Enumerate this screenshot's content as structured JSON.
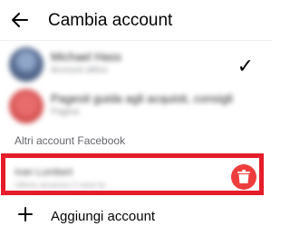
{
  "header": {
    "title": "Cambia account",
    "back_icon": "arrow-left-icon"
  },
  "accounts": [
    {
      "name": "Michael Hass",
      "subtitle": "Account attivo",
      "selected": true
    },
    {
      "name": "Pagesit guida agli acquisti, consigli",
      "subtitle": "Pagina",
      "selected": false
    }
  ],
  "section": {
    "label": "Altri account Facebook"
  },
  "other_account": {
    "name": "Ivan Lumbert",
    "subtitle": "Ultimo accesso 2 mesi fa"
  },
  "add_account": {
    "label": "Aggiungi account"
  },
  "colors": {
    "highlight": "#e51c2a",
    "delete_button": "#ee3d3d"
  }
}
